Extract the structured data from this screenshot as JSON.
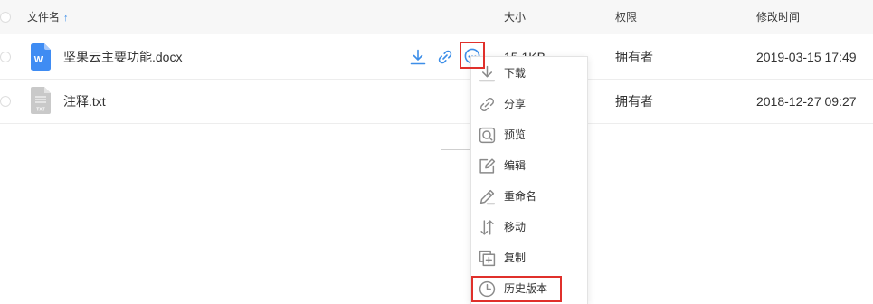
{
  "colors": {
    "accent": "#3d8ee8",
    "annotation": "#e0302b",
    "header_bg": "#f7f7f7",
    "word_icon": "#3f8cf3",
    "txt_icon": "#c9c9c9"
  },
  "header": {
    "name_label": "文件名",
    "sort_arrow": "↑",
    "size_label": "大小",
    "permission_label": "权限",
    "modified_label": "修改时间"
  },
  "files": [
    {
      "name": "坚果云主要功能.docx",
      "icon": "word-document-icon",
      "icon_text": "W",
      "size": "15.1KB",
      "permission": "拥有者",
      "modified": "2019-03-15 17:49"
    },
    {
      "name": "注释.txt",
      "icon": "txt-document-icon",
      "icon_text": "TXT",
      "permission": "拥有者",
      "modified": "2018-12-27 09:27"
    }
  ],
  "row_actions": [
    {
      "icon": "download-icon"
    },
    {
      "icon": "link-icon"
    },
    {
      "icon": "more-options-icon",
      "highlighted": true
    }
  ],
  "context_menu": {
    "items": [
      {
        "label": "下载",
        "icon": "download-icon"
      },
      {
        "label": "分享",
        "icon": "link-icon"
      },
      {
        "label": "预览",
        "icon": "preview-icon"
      },
      {
        "label": "编辑",
        "icon": "edit-icon"
      },
      {
        "label": "重命名",
        "icon": "rename-pencil-icon"
      },
      {
        "label": "移动",
        "icon": "move-arrows-icon"
      },
      {
        "label": "复制",
        "icon": "copy-icon"
      },
      {
        "label": "历史版本",
        "icon": "history-clock-icon",
        "highlighted": true
      }
    ]
  }
}
